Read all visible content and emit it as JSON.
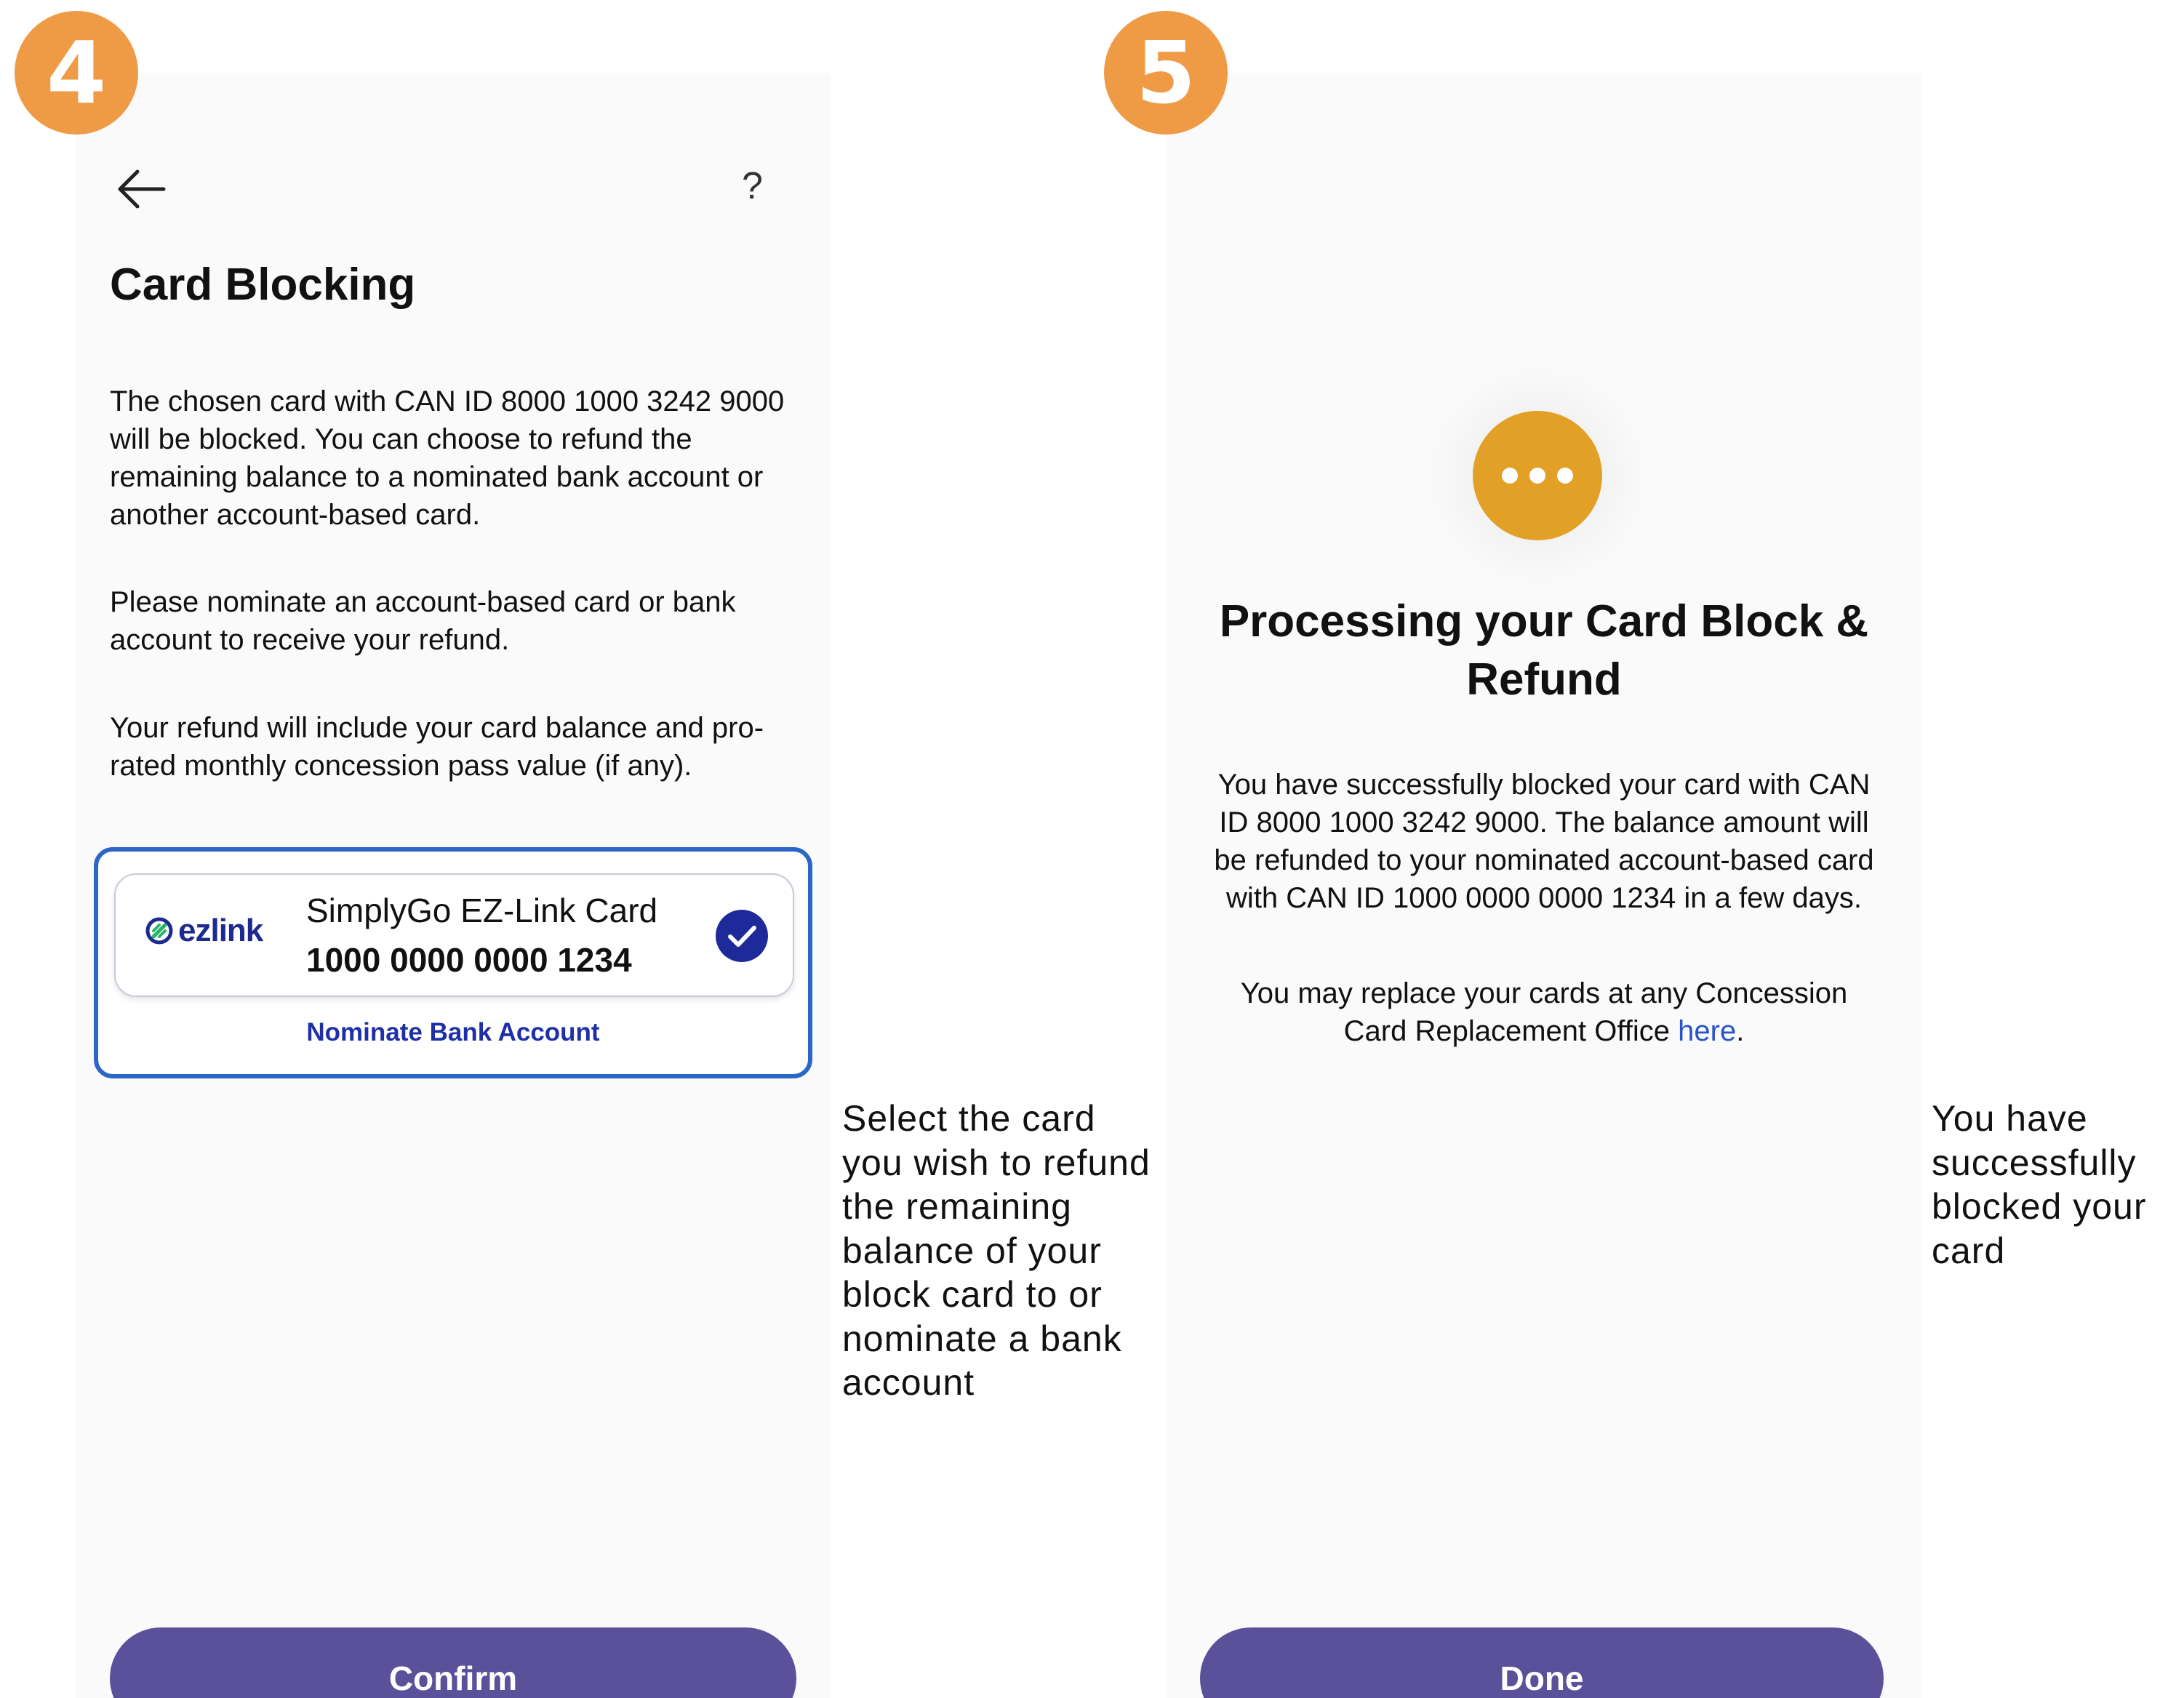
{
  "step4": {
    "badge": "4",
    "help_label": "?",
    "title": "Card Blocking",
    "paragraph_1": "The chosen card with CAN ID 8000 1000 3242 9000 will be blocked. You can choose to refund the remaining balance to a nominated bank account or another account-based card.",
    "paragraph_2": "Please nominate an account-based card or bank account to receive your refund.",
    "paragraph_3": "Your refund will include your card balance and pro-rated monthly concession pass value (if any).",
    "card": {
      "logo_text": "ezlink",
      "name": "SimplyGo EZ-Link Card",
      "number": "1000 0000 0000 1234",
      "selected": true
    },
    "nominate_bank_label": "Nominate Bank Account",
    "confirm_label": "Confirm",
    "caption": "Select the card you wish to refund the remaining balance of your block card to or nominate a bank account"
  },
  "step5": {
    "badge": "5",
    "title": "Processing your Card Block & Refund",
    "paragraph_1": "You have successfully blocked your card with CAN ID 8000 1000 3242 9000. The balance amount will be refunded to your nominated account-based card with CAN ID 1000 0000 0000 1234 in a few days.",
    "paragraph_2_prefix": "You may replace your cards at any Concession Card Replacement Office ",
    "here_link": "here",
    "paragraph_2_suffix": ".",
    "done_label": "Done",
    "caption": "You have successfully blocked your card"
  },
  "colors": {
    "badge": "#ef9a45",
    "primary_button": "#5b519b",
    "selection_border": "#2b65c6",
    "check": "#1f2a9a",
    "processing_icon": "#e3a026",
    "link": "#2a52c9"
  },
  "icons": {
    "back": "arrow-left-icon",
    "help": "question-mark-icon",
    "check": "check-circle-icon",
    "processing": "more-horizontal-icon"
  }
}
